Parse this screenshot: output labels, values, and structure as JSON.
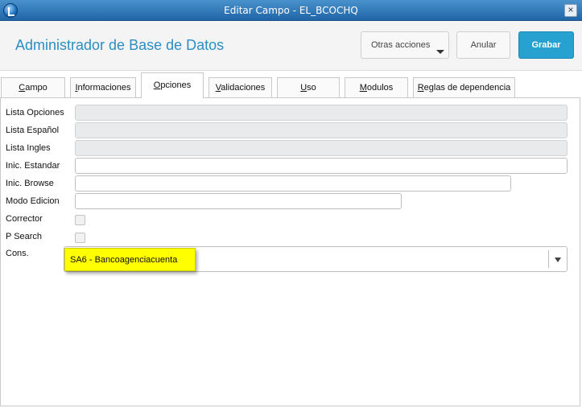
{
  "window": {
    "title": "Editar Campo - EL_BCOCHQ",
    "close_label": "×"
  },
  "header": {
    "app_title": "Administrador de Base de Datos",
    "otras_acciones": "Otras acciones",
    "anular": "Anular",
    "grabar": "Grabar"
  },
  "tabs": [
    {
      "label": "Campo",
      "u": "C",
      "rest": "ampo"
    },
    {
      "label": "Informaciones",
      "u": "I",
      "rest": "nformaciones"
    },
    {
      "label": "Opciones",
      "u": "O",
      "rest": "pciones",
      "active": true
    },
    {
      "label": "Validaciones",
      "u": "V",
      "rest": "alidaciones"
    },
    {
      "label": "Uso",
      "u": "U",
      "rest": "so"
    },
    {
      "label": "Modulos",
      "u": "M",
      "rest": "odulos"
    },
    {
      "label": "Reglas de dependencia",
      "u": "R",
      "rest": "eglas de dependencia"
    }
  ],
  "form": {
    "lista_opciones": {
      "label": "Lista Opciones",
      "value": ""
    },
    "lista_espanol": {
      "label": "Lista Español",
      "value": ""
    },
    "lista_ingles": {
      "label": "Lista Ingles",
      "value": ""
    },
    "inic_estandar": {
      "label": "Inic. Estandar",
      "value": ""
    },
    "inic_browse": {
      "label": "Inic. Browse",
      "value": ""
    },
    "modo_edicion": {
      "label": "Modo Edicion",
      "value": ""
    },
    "corrector": {
      "label": "Corrector",
      "checked": false
    },
    "p_search": {
      "label": "P Search",
      "checked": false
    },
    "cons": {
      "label": "Cons.",
      "value": ""
    }
  },
  "tooltip": {
    "text": "SA6 - Bancoagenciacuenta"
  },
  "colors": {
    "accent": "#27a1cf",
    "title_blue": "#2b8ec4",
    "tooltip_bg": "#ffff00"
  }
}
